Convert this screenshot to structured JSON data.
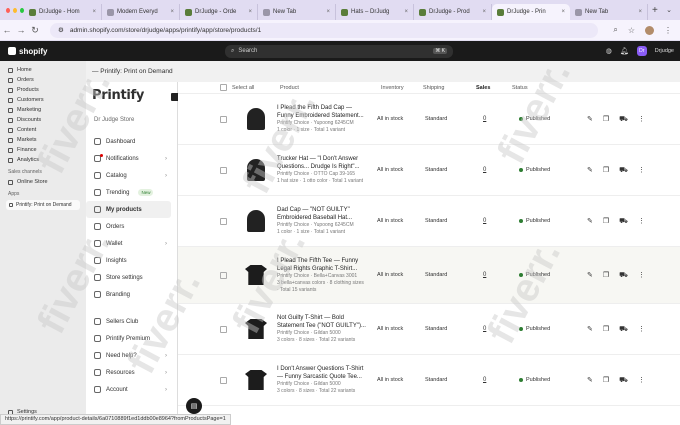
{
  "browser": {
    "tabs": [
      {
        "label": "DrJudge - Hom"
      },
      {
        "label": "Modern Everyd"
      },
      {
        "label": "DrJudge - Orde"
      },
      {
        "label": "New Tab"
      },
      {
        "label": "Hats – DrJudg"
      },
      {
        "label": "DrJudge - Prod"
      },
      {
        "label": "DrJudge - Prin",
        "active": true
      },
      {
        "label": "New Tab"
      }
    ],
    "url": "admin.shopify.com/store/drjudge/apps/printify/app/store/products/1",
    "status_url": "https://printify.com/app/product-details/6a0710889f1ed1ddb00e8964?fromProductsPage=1"
  },
  "shopify": {
    "logo": "shopify",
    "search_placeholder": "Search",
    "shortcut": "⌘ K",
    "user": "Drjudge",
    "user_initials": "Dr",
    "nav": [
      "Home",
      "Orders",
      "Products",
      "Customers",
      "Marketing",
      "Discounts",
      "Content",
      "Markets",
      "Finance",
      "Analytics"
    ],
    "sales_channels_label": "Sales channels",
    "online_store": "Online Store",
    "apps_label": "Apps",
    "app_item": "Printify: Print on Demand",
    "settings": "Settings"
  },
  "app_title": "— Printify: Print on Demand",
  "printify": {
    "brand": "Printify",
    "store": "Dr Judge Store",
    "nav": [
      {
        "label": "Dashboard"
      },
      {
        "label": "Notifications",
        "chev": true,
        "dot": true
      },
      {
        "label": "Catalog",
        "chev": true
      },
      {
        "label": "Trending",
        "badge": "New"
      },
      {
        "label": "My products",
        "selected": true
      },
      {
        "label": "Orders"
      },
      {
        "label": "Wallet",
        "chev": true
      },
      {
        "label": "Insights"
      },
      {
        "label": "Store settings"
      },
      {
        "label": "Branding"
      },
      {
        "label": ""
      },
      {
        "label": "Sellers Club"
      },
      {
        "label": "Printify Premium"
      },
      {
        "label": "Need help?",
        "chev": true
      },
      {
        "label": "Resources",
        "chev": true
      },
      {
        "label": "Account",
        "chev": true
      }
    ]
  },
  "table": {
    "headers": {
      "select_all": "Select all",
      "product": "Product",
      "inventory": "Inventory",
      "shipping": "Shipping",
      "sales": "Sales",
      "status": "Status"
    },
    "rows": [
      {
        "title1": "I Plead the Fifth Dad Cap —",
        "title2": "Funny Embroidered Statement...",
        "meta1": "Printify Choice · Yupoong 6245CM",
        "meta2": "1 color · 1 size · Total 1 variant",
        "meta3": "",
        "inventory": "All in stock",
        "shipping": "Standard",
        "sales": "0",
        "status": "Published",
        "img": "cap"
      },
      {
        "title1": "Trucker Hat — \"I Don't Answer",
        "title2": "Questions... Drudge Is Right\"...",
        "meta1": "Printify Choice · OTTO Cap 39-165",
        "meta2": "1 hat size · 1 otto color · Total 1 variant",
        "meta3": "",
        "inventory": "All in stock",
        "shipping": "Standard",
        "sales": "0",
        "status": "Published",
        "img": "cap"
      },
      {
        "title1": "Dad Cap — \"NOT GUILTY\"",
        "title2": "Embroidered Baseball Hat...",
        "meta1": "Printify Choice · Yupoong 6245CM",
        "meta2": "1 color · 1 size · Total 1 variant",
        "meta3": "",
        "inventory": "All in stock",
        "shipping": "Standard",
        "sales": "0",
        "status": "Published",
        "img": "cap"
      },
      {
        "title1": "I Plead The Fifth Tee — Funny",
        "title2": "Legal Rights Graphic T-Shirt...",
        "meta1": "Printify Choice · Bella+Canvas 3001",
        "meta2": "3 bella+canvas colors · 8 clothing sizes",
        "meta3": "· Total 15 variants",
        "inventory": "All in stock",
        "shipping": "Standard",
        "sales": "0",
        "status": "Published",
        "img": "shirt",
        "highlight": true
      },
      {
        "title1": "Not Guilty T-Shirt — Bold",
        "title2": "Statement Tee (\"NOT GUILTY\")...",
        "meta1": "Printify Choice · Gildan 5000",
        "meta2": "3 colors · 8 sizes · Total 22 variants",
        "meta3": "",
        "inventory": "All in stock",
        "shipping": "Standard",
        "sales": "0",
        "status": "Published",
        "img": "shirt"
      },
      {
        "title1": "I Don't Answer Questions T-Shirt",
        "title2": "— Funny Sarcastic Quote Tee...",
        "meta1": "Printify Choice · Gildan 5000",
        "meta2": "3 colors · 8 sizes · Total 22 variants",
        "meta3": "",
        "inventory": "All in stock",
        "shipping": "Standard",
        "sales": "0",
        "status": "Published",
        "img": "shirt"
      }
    ]
  },
  "watermark": "fiverr."
}
